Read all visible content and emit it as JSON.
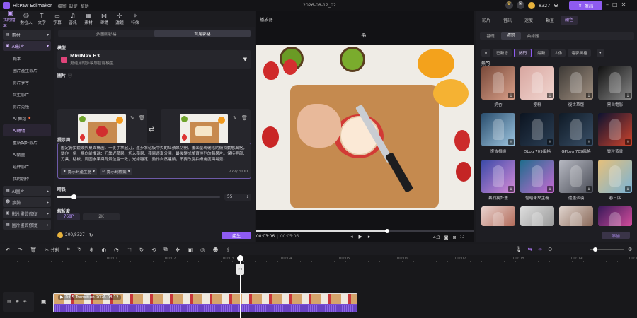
{
  "app": {
    "title": "HitPaw Edimakor",
    "menu": [
      "檔案",
      "設定",
      "幫助"
    ],
    "date_title": "2026-08-12_02",
    "credits": "8327",
    "export_label": "匯出"
  },
  "toolbar": {
    "tabs": [
      "我的檔案",
      "數位人",
      "文字",
      "字幕",
      "音訊",
      "素材",
      "轉場",
      "濾鏡",
      "特效"
    ]
  },
  "sidebar": {
    "groups": [
      {
        "label": "素材"
      },
      {
        "label": "AI影片"
      }
    ],
    "ai_video_items": [
      "範本",
      "圖片產生影片",
      "影片參考",
      "文生影片",
      "影片克隆",
      "AI 舞蹈",
      "AI轉場",
      "重新設計影片",
      "AI動畫",
      "延伸影片",
      "我的創作"
    ],
    "selected_item": "AI轉場",
    "bottom_groups": [
      "AI圖片",
      "換臉",
      "影片畫質修復",
      "圖片畫質修復"
    ]
  },
  "gen": {
    "tabs": [
      "多圖關影格",
      "首尾影格"
    ],
    "active_tab": "首尾影格",
    "model_label": "模型",
    "model_name": "MiniMax H3",
    "model_desc": "更適用的多模態智能模型",
    "images_label": "圖片",
    "prompt_label": "提示詞",
    "prompt_text": "固定俯拍鏡頭與桌面構圖，一隻手拿起刀，逐步將砧板中央的紅蘋果切開。畫面呈現俐落的俯拍動態風格，動作一氣一熅向前推進：刀靠近蘋果、切入蘋果、蘋果逐漸分開，最後變成整齊排列的蘋果片。保持手部、刀具、砧板、周圍水果與背景位置一致，光線穩定，動作自然連續，不要改變拍攝角度與場景。",
    "prompt_btn1": "提示詞產生器",
    "prompt_btn2": "提示詞標籤",
    "prompt_count": "272/7000",
    "duration_label": "時長",
    "duration_value": "55",
    "duration_fraction": 0.1,
    "resolution_label": "解析度",
    "resolutions": [
      "768P",
      "2K"
    ],
    "active_resolution": "768P",
    "cost": "200/8327",
    "generate_label": "產生"
  },
  "preview": {
    "title": "播放器",
    "current_time": "00:03:06",
    "total_time": "00:05:06",
    "ratio": "4:3",
    "progress": 0.6
  },
  "right": {
    "top_tabs": [
      "影片",
      "音訊",
      "速度",
      "動畫",
      "顏色"
    ],
    "active_top": "顏色",
    "sub_tabs": [
      "基礎",
      "濾鏡",
      "曲線器"
    ],
    "active_sub": "濾鏡",
    "filter_tabs": [
      "已新增",
      "熱門",
      "最新",
      "人像",
      "電影風格"
    ],
    "active_filter": "熱門",
    "section_label": "熱門",
    "tiles": [
      "奶杏",
      "櫻粉",
      "復古草版",
      "黑白電影",
      "復古相機",
      "DLog 709風格",
      "GPLog 709風格",
      "質粒黃昏",
      "暴烈獨計畫",
      "惶暗未來主義",
      "遭遇沙漠",
      "春日序",
      "",
      "",
      "",
      ""
    ],
    "apply_label": "添加"
  },
  "timeline": {
    "ruler": [
      "00:01",
      "00:02",
      "00:03",
      "00:04",
      "00:05",
      "00:06",
      "00:07",
      "00:08",
      "00:09",
      "00:10"
    ],
    "cut_label": "分割",
    "clip_title": "0:05 Transition 2026 08 12",
    "colors": {
      "accent": "#8e5bf0",
      "clip": "#7a4fd6",
      "playhead": "#ffffff"
    }
  }
}
